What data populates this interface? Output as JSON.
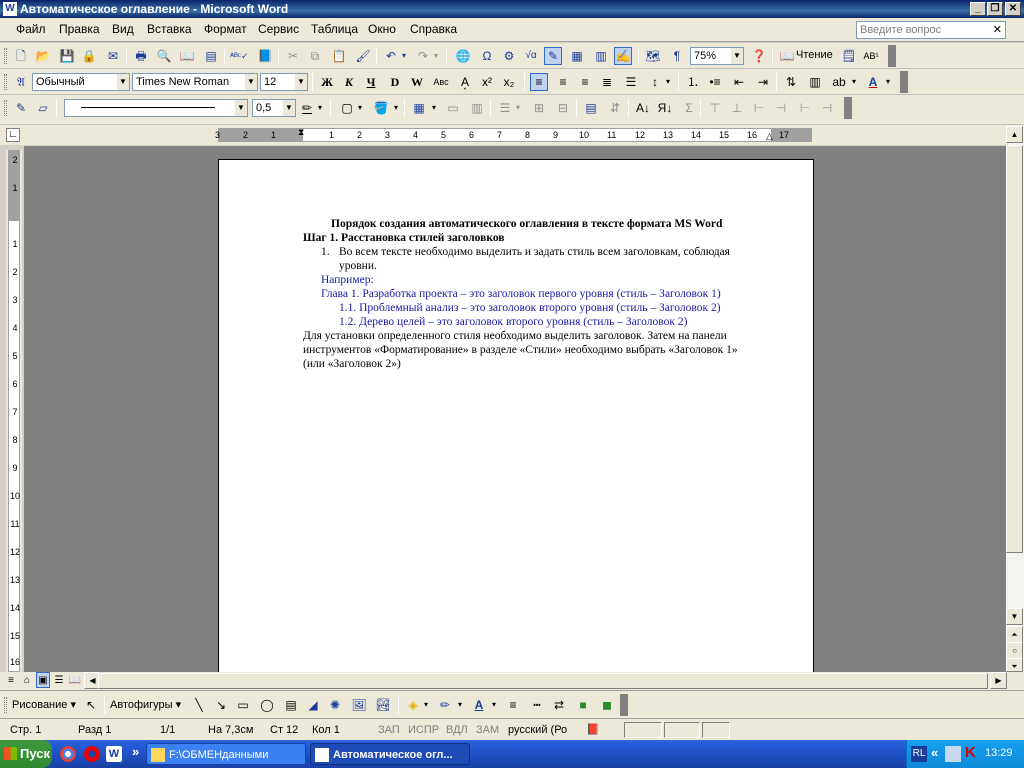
{
  "window": {
    "title": "Автоматическое оглавление - Microsoft Word"
  },
  "menu": {
    "items": [
      "Файл",
      "Правка",
      "Вид",
      "Вставка",
      "Формат",
      "Сервис",
      "Таблица",
      "Окно",
      "Справка"
    ],
    "ask_placeholder": "Введите вопрос"
  },
  "standard_toolbar": {
    "zoom": "75%",
    "reading_label": "Чтение"
  },
  "format_toolbar": {
    "style": "Обычный",
    "font": "Times New Roman",
    "size": "12"
  },
  "tables_toolbar": {
    "line_weight": "0,5"
  },
  "ruler": {
    "labels": [
      "3",
      "2",
      "1",
      "1",
      "2",
      "3",
      "4",
      "5",
      "6",
      "7",
      "8",
      "9",
      "10",
      "11",
      "12",
      "13",
      "14",
      "15",
      "16",
      "17"
    ]
  },
  "vruler": {
    "labels": [
      "2",
      "1",
      "1",
      "2",
      "3",
      "4",
      "5",
      "6",
      "7",
      "8",
      "9",
      "10",
      "11",
      "12",
      "13",
      "14",
      "15",
      "16"
    ]
  },
  "document": {
    "title": "Порядок создания автоматического оглавления в тексте  формата MS Word",
    "step1": "Шаг 1. Расстановка стилей заголовков",
    "list_num": "1.",
    "list_line1": "Во всем тексте необходимо выделить и задать стиль всем заголовкам, соблюдая",
    "list_line2": "уровни.",
    "example_label": "Например:",
    "h1": "Глава 1. Разработка проекта – это заголовок первого уровня (стиль – Заголовок 1)",
    "h2a": "1.1. Проблемный анализ – это заголовок второго уровня (стиль – Заголовок 2)",
    "h2b": "1.2. Дерево целей – это заголовок второго уровня (стиль – Заголовок 2)",
    "para_line1": "Для установки определенного стиля необходимо выделить заголовок. Затем на панели",
    "para_line2": "инструментов «Форматирование» в разделе «Стили» необходимо выбрать «Заголовок 1»",
    "para_line3": "(или «Заголовок 2»)"
  },
  "drawing_toolbar": {
    "drawing_label": "Рисование",
    "autoshapes_label": "Автофигуры"
  },
  "status": {
    "page": "Стр.   1",
    "section": "Разд   1",
    "pages": "1/1",
    "at": "На  7,3см",
    "line": "Ст  12",
    "col": "Кол  1",
    "rec": "ЗАП",
    "trk": "ИСПР",
    "ext": "ВДЛ",
    "ovr": "ЗАМ",
    "lang": "русский (Ро"
  },
  "taskbar": {
    "start": "Пуск",
    "tasks": [
      "F:\\ОБМЕНданными",
      "Автоматическое огл..."
    ],
    "lang": "RL",
    "time": "13:29"
  },
  "colors": {
    "heading_blue": "#1a1aa6",
    "title_bar": "#0a246a",
    "workspace_gray": "#808080"
  }
}
